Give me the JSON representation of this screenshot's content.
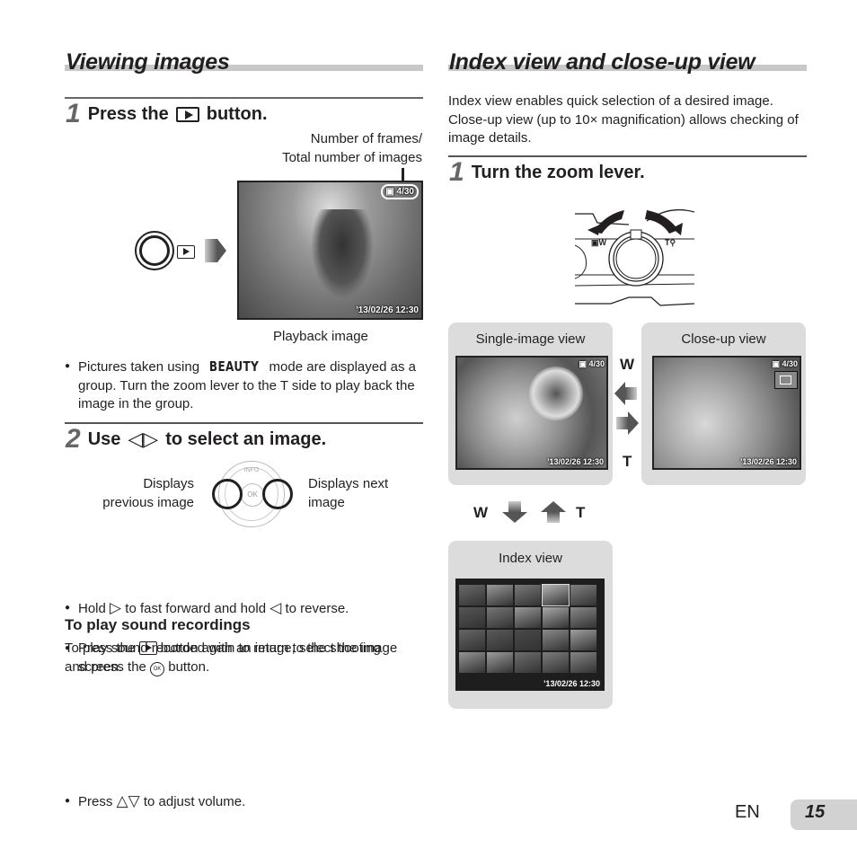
{
  "left": {
    "title": "Viewing images",
    "step1": {
      "number": "1",
      "text_before": "Press the",
      "icon": "playback-button-icon",
      "text_after": "button.",
      "callout": [
        "Number of frames/",
        "Total number of images"
      ],
      "osd_counter": "4/30",
      "osd_datetime": "'13/02/26  12:30",
      "caption": "Playback image"
    },
    "note": {
      "text_before": "Pictures taken using",
      "mode_badge": "BEAUTY",
      "text_after": "mode are displayed as a group. Turn the zoom lever to the T side to play back the image in the group."
    },
    "step2": {
      "number": "2",
      "text_before": "Use",
      "arrows": "◁▷",
      "text_after": "to select an image.",
      "label_prev": [
        "Displays",
        "previous image"
      ],
      "label_next": [
        "Displays next",
        "image"
      ],
      "dial_top": "INFO",
      "dial_center": "OK"
    },
    "bullets": [
      {
        "before": "Hold",
        "sym1": "▷",
        "mid": "to fast forward and hold",
        "sym2": "◁",
        "after": "to reverse."
      },
      {
        "before": "Press the",
        "after": "button again to return to the shooting screen."
      }
    ],
    "sound": {
      "heading": "To play sound recordings",
      "para_before": "To play sound recorded with an image, select the image and press the",
      "ok_icon": "OK",
      "para_after": "button.",
      "bullet_before": "Press",
      "bullet_sym": "△▽",
      "bullet_after": "to adjust volume."
    }
  },
  "right": {
    "title": "Index view and close-up view",
    "intro": "Index view enables quick selection of a desired image. Close-up view (up to 10× magnification) allows checking of image details.",
    "step1": {
      "number": "1",
      "text": "Turn the zoom lever."
    },
    "lever_labels": {
      "w": "W",
      "t": "T"
    },
    "single_view": {
      "label": "Single-image view",
      "counter": "4/30",
      "datetime": "'13/02/26  12:30"
    },
    "closeup_view": {
      "label": "Close-up view",
      "counter": "4/30",
      "datetime": "'13/02/26  12:30"
    },
    "arrow_w": "W",
    "arrow_t": "T",
    "vert_w": "W",
    "vert_t": "T",
    "index_view": {
      "label": "Index view",
      "datetime": "'13/02/26  12:30"
    }
  },
  "footer": {
    "lang": "EN",
    "page": "15"
  }
}
